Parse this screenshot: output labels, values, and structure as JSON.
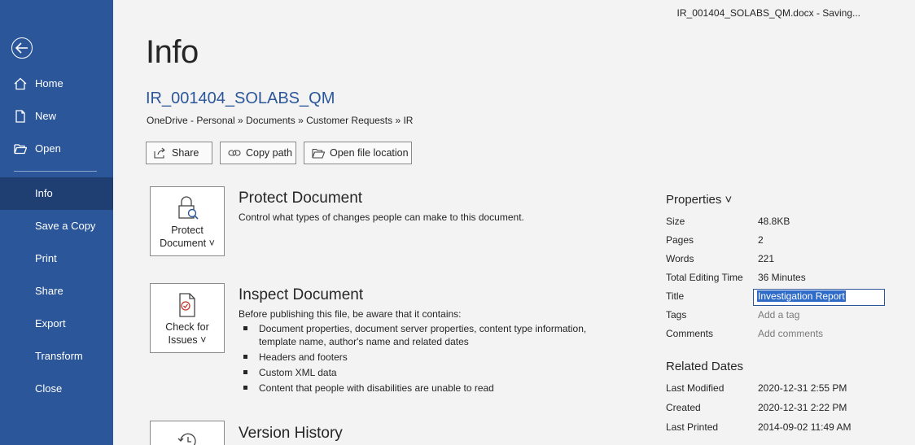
{
  "window": {
    "status": "IR_001404_SOLABS_QM.docx  -  Saving..."
  },
  "sidebar": {
    "items": [
      {
        "label": "Home",
        "icon": "home-icon"
      },
      {
        "label": "New",
        "icon": "new-document-icon"
      },
      {
        "label": "Open",
        "icon": "folder-open-icon"
      },
      {
        "label": "Info"
      },
      {
        "label": "Save a Copy"
      },
      {
        "label": "Print"
      },
      {
        "label": "Share"
      },
      {
        "label": "Export"
      },
      {
        "label": "Transform"
      },
      {
        "label": "Close"
      }
    ]
  },
  "main": {
    "title": "Info",
    "doc_name": "IR_001404_SOLABS_QM",
    "path": "OneDrive - Personal » Documents » Customer Requests » IR",
    "actions": {
      "share": "Share",
      "copy_path": "Copy path",
      "open_location": "Open file location"
    },
    "protect": {
      "tile_line1": "Protect",
      "tile_line2": "Document ˅",
      "title": "Protect Document",
      "desc": "Control what types of changes people can make to this document."
    },
    "inspect": {
      "tile_line1": "Check for",
      "tile_line2": "Issues ˅",
      "title": "Inspect Document",
      "desc": "Before publishing this file, be aware that it contains:",
      "bullets": [
        "Document properties, document server properties, content type information, template name, author's name and related dates",
        "Headers and footers",
        "Custom XML data",
        "Content that people with disabilities are unable to read"
      ]
    },
    "version": {
      "title": "Version History"
    }
  },
  "properties": {
    "heading": "Properties ˅",
    "size_k": "Size",
    "size_v": "48.8KB",
    "pages_k": "Pages",
    "pages_v": "2",
    "words_k": "Words",
    "words_v": "221",
    "time_k": "Total Editing Time",
    "time_v": "36 Minutes",
    "title_k": "Title",
    "title_v": "Investigation Report",
    "tags_k": "Tags",
    "tags_v": "Add a tag",
    "comments_k": "Comments",
    "comments_v": "Add comments"
  },
  "related": {
    "heading": "Related Dates",
    "modified_k": "Last Modified",
    "modified_v": "2020-12-31 2:55 PM",
    "created_k": "Created",
    "created_v": "2020-12-31 2:22 PM",
    "printed_k": "Last Printed",
    "printed_v": "2014-09-02 11:49 AM"
  }
}
